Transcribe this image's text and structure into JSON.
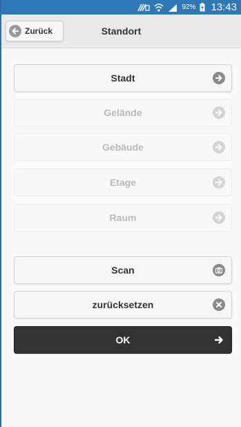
{
  "status_bar": {
    "battery_percent": "92%",
    "time": "13:43"
  },
  "header": {
    "back_label": "Zurück",
    "title": "Standort"
  },
  "location_levels": [
    {
      "label": "Stadt",
      "enabled": true
    },
    {
      "label": "Gelände",
      "enabled": false
    },
    {
      "label": "Gebäude",
      "enabled": false
    },
    {
      "label": "Etage",
      "enabled": false
    },
    {
      "label": "Raum",
      "enabled": false
    }
  ],
  "actions": {
    "scan_label": "Scan",
    "reset_label": "zurücksetzen",
    "ok_label": "OK"
  },
  "icons": {
    "back": "arrow-left-circle-icon",
    "level": "arrow-right-circle-icon",
    "scan": "camera-icon",
    "reset": "close-circle-icon",
    "ok": "arrow-right-icon"
  },
  "colors": {
    "status_bar": "#2e78b5",
    "header_bg": "#e9e9e9",
    "button_bg": "#f6f6f6",
    "primary_button_bg": "#333333",
    "icon_gray": "#8a8a8a"
  }
}
